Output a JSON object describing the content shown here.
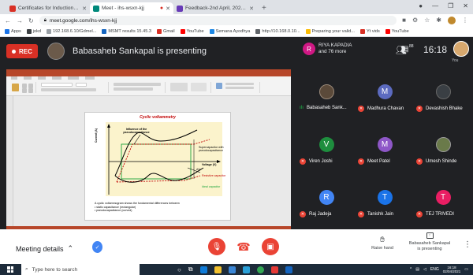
{
  "browser": {
    "tabs": [
      {
        "title": "Certificates for Induction Progra...",
        "favicon_color": "#1a73e8",
        "active": false
      },
      {
        "title": "Meet - ihs-wsxn-kjj",
        "favicon_color": "#00897b",
        "active": true
      },
      {
        "title": "Feedback-2nd April, 2021 - Goo...",
        "favicon_color": "#673ab7",
        "active": false
      }
    ],
    "new_tab": "+",
    "url": "meet.google.com/ihs-wsxn-kjj",
    "bookmarks": [
      "Apps",
      "jokd",
      "192.168.6.10/Gdmel...",
      "MSMT results 15.45.3",
      "Gmail",
      "YouTube",
      "Semana Ayodhya",
      "http://10.168.0.10...",
      "Preparing your valid...",
      "Yt vids",
      "YouTube"
    ]
  },
  "meet": {
    "rec_label": "REC",
    "presenting_text": "Babasaheb Sankapal is presenting",
    "host_initial": "R",
    "host_name_line1": "RIYA KAPADIA",
    "host_name_line2": "and 76 more",
    "people_count": "88",
    "clock": "16:18",
    "you_label": "You"
  },
  "slide": {
    "title": "Cyclic voltammetry",
    "caption_line1": "A cyclic voltammogram shows the fundamental differences between",
    "caption_line2": "• static capacitance (rectangular)",
    "caption_line3": "• pseudocapacitance (curved)",
    "labels": {
      "influence": "Influence of the pseudocapacitance",
      "supercap": "Supercapacitor with pseudocapacitance",
      "resistive": "Resistive capacitor",
      "ideal": "Ideal capacitor",
      "voltage": "Voltage (V)",
      "current": "Current (A)",
      "delta": "ΔV"
    }
  },
  "participants": [
    {
      "name": "Babasaheb Sank...",
      "initial": "",
      "color": "#5b4a3a",
      "speaking": true
    },
    {
      "name": "Madhura Chavan",
      "initial": "M",
      "color": "#5c6bc0",
      "speaking": false
    },
    {
      "name": "Devashish Bhake",
      "initial": "",
      "color": "#3a3f44",
      "speaking": false
    },
    {
      "name": "Viren Joshi",
      "initial": "V",
      "color": "#1e8e3e",
      "speaking": false
    },
    {
      "name": "Meet Patel",
      "initial": "M",
      "color": "#8e57c7",
      "speaking": false
    },
    {
      "name": "Umesh Shinde",
      "initial": "",
      "color": "#6a7a4a",
      "speaking": false
    },
    {
      "name": "Raj Jadeja",
      "initial": "R",
      "color": "#4285f4",
      "speaking": false
    },
    {
      "name": "Tanishk Jain",
      "initial": "T",
      "color": "#1a73e8",
      "speaking": false
    },
    {
      "name": "TEJ TRIVEDI",
      "initial": "T",
      "color": "#e91e63",
      "speaking": false
    }
  ],
  "controls": {
    "meeting_details": "Meeting details",
    "raise_hand": "Raise hand",
    "presenter_line1": "Babasaheb Sankapal",
    "presenter_line2": "is presenting"
  },
  "taskbar": {
    "search_placeholder": "Type here to search",
    "lang": "ENG",
    "time": "16:18",
    "date": "02/04/2021"
  },
  "colors": {
    "meet_bg": "#202124",
    "danger": "#ea4335",
    "rec": "#d93025",
    "ppt_accent": "#b7472a"
  }
}
